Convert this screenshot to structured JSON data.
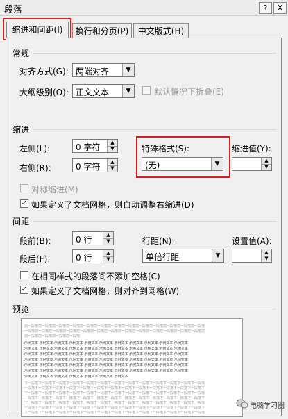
{
  "dialog": {
    "title": "段落",
    "help_icon": "?",
    "close_icon": "X"
  },
  "tabs": [
    {
      "label": "缩进和间距(I)"
    },
    {
      "label": "换行和分页(P)"
    },
    {
      "label": "中文版式(H)"
    }
  ],
  "general": {
    "section_label": "常规",
    "alignment_label": "对齐方式(G):",
    "alignment_value": "两端对齐",
    "outline_label": "大纲级别(O):",
    "outline_value": "正文文本",
    "collapse_label": "默认情况下折叠(E)"
  },
  "indent": {
    "section_label": "缩进",
    "left_label": "左侧(L):",
    "left_value": "0 字符",
    "right_label": "右侧(R):",
    "right_value": "0 字符",
    "special_label": "特殊格式(S):",
    "special_value": "(无)",
    "indent_value_label": "缩进值(Y):",
    "mirror_label": "对称缩进(M)",
    "auto_adjust_label": "如果定义了文档网格，则自动调整右缩进(D)"
  },
  "spacing": {
    "section_label": "间距",
    "before_label": "段前(B):",
    "before_value": "0 行",
    "after_label": "段后(F):",
    "after_value": "0 行",
    "line_spacing_label": "行距(N):",
    "line_spacing_value": "单倍行距",
    "set_value_label": "设置值(A):",
    "no_space_label": "在相同样式的段落间不添加空格(C)",
    "snap_grid_label": "如果定义了文档网格，则对齐到网格(W)"
  },
  "preview": {
    "section_label": "预览",
    "prev_para_1": "前一段落前一段落前一段落前一段落前一段落前一段落前一段落前一段落前一段落前一段落前一段落前一段落前一段落",
    "prev_para_2": "一段落前一段落前一段落前一段落前一段落前一段落前一段落前一段落前一段落前一段落前一段落前一段落前一段落前",
    "prev_para_3": "前一段落前一段落前一段落前一段落",
    "sample_1": "示例文本 示例文本 示例文本 示例文本 示例文本 示例文本 示例文本 示例文本 示例文本 示例文本 示例文本",
    "sample_2": "示例文本 示例文本 示例文本 示例文本 示例文本 示例文本 示例文本 示例文本 示例文本 示例文本 示例文本",
    "sample_3": "示例文本 示例文本 示例文本 示例文本 示例文本 示例文本 示例文本 示例文本 示例文本 示例文本 示例文本",
    "sample_4": "示例文本 示例文本 示例文本 示例文本 示例文本 示例文本 示例文本 示例文本 示例文本 示例文本 示例文本",
    "sample_5": "示例文本 示例文本 示例文本 示例文本 示例文本 示例文本 示例文本 示例文本 示例文本 示例文本 示例文本",
    "sample_6": "示例文本 示例文本 示例文本 示例文本 示例文本 示例文本 示例文本 示例文本 示例文本 示例文本 示例文本",
    "sample_7": "示例文本 示例文本 示例文本 示例文本 示例文本 示例文本 示例文本",
    "next_para_1": "下一段落下一段落下一段落下一段落下一段落下一段落下一段落下一段落下一段落下一段落下一段落下一段落下一段落",
    "next_para_2": "一段落下一段落下一段落下一段落下一段落下一段落下一段落下一段落下一段落下一段落下一段落下一段落下一段落下",
    "next_para_3": "下一段落下一段落下一段落下一段落下一段落下一段落下一段落下一段落下一段落下一段落下一段落下一段落下一段落",
    "next_para_4": "一段落下一段落下一段落下一段落下一段落下一段落下一段落下一段落下一段落下一段落下一段落下一段落下一段落下",
    "next_para_5": "下一段落下一段落下一段落下一段落下一段落下一段落下一段落下一段落下一段落下一段落下一段落下一段落下一段落",
    "next_para_6": "一段落下一段落下一段落下一段落下一段落下一段落下一段落下一段落下一段落下一段落下一段落下一段落下一段落下",
    "next_para_7": "下一段落下一段落下一段落下一段落下一段落下一段落下一段落下一段落下一段落下一段落下一段落下一段落下一段落"
  },
  "watermark": {
    "text": "电脑学习圈"
  },
  "colors": {
    "highlight": "#d61f1f",
    "dialog_bg": "#f0f0f0"
  }
}
